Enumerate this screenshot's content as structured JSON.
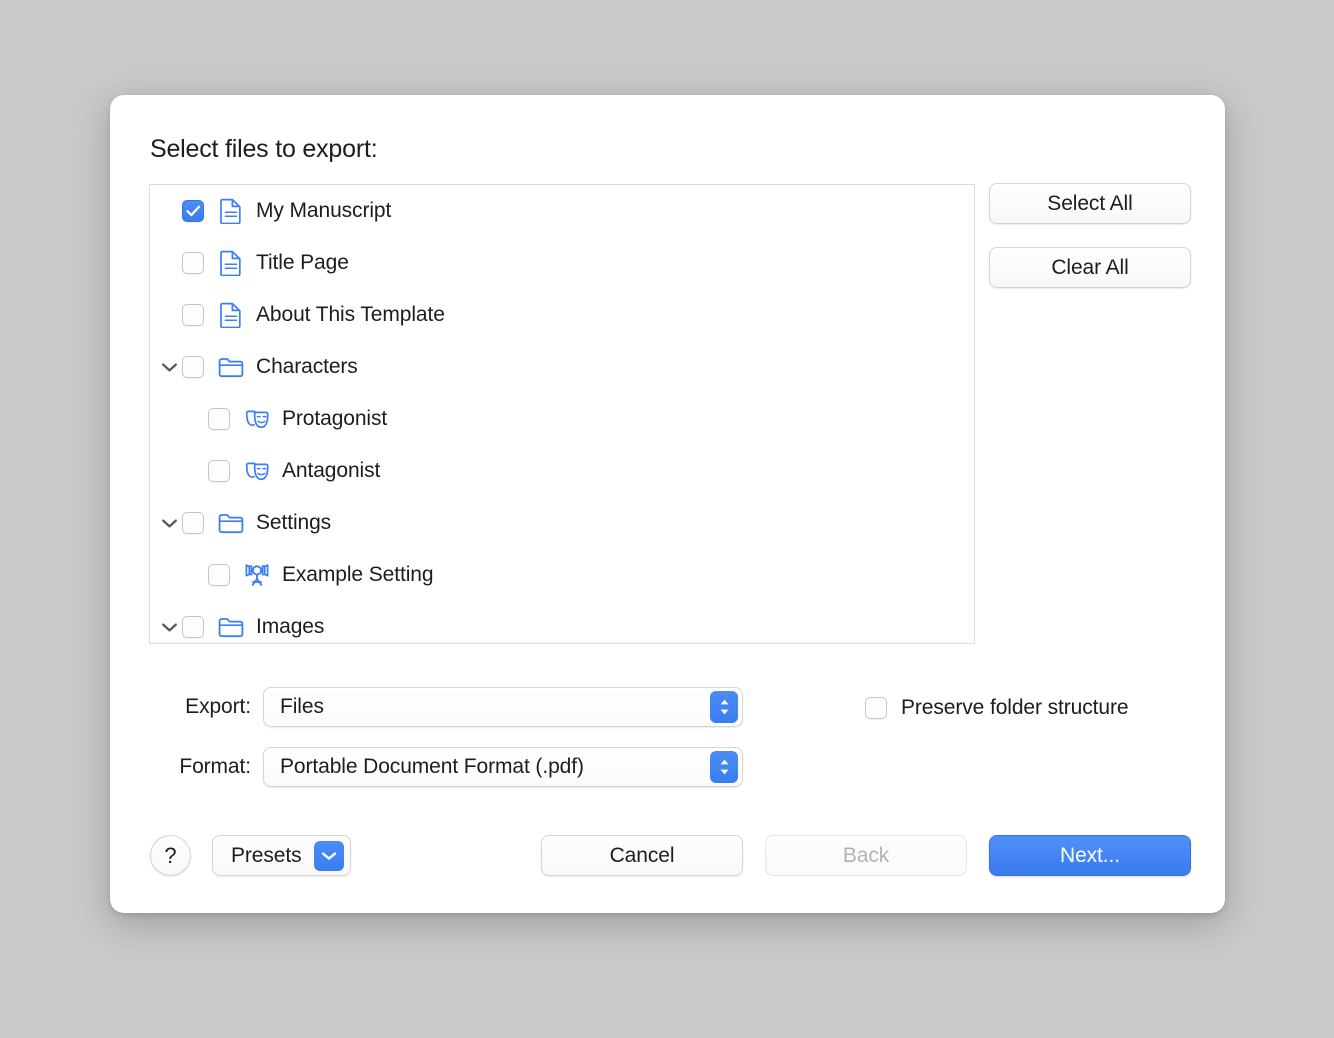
{
  "dialog": {
    "title": "Select files to export:"
  },
  "file_list": {
    "items": [
      {
        "label": "My Manuscript",
        "icon": "document-icon",
        "checked": true,
        "disclosure": "none",
        "indent": 0
      },
      {
        "label": "Title Page",
        "icon": "document-icon",
        "checked": false,
        "disclosure": "none",
        "indent": 0
      },
      {
        "label": "About This Template",
        "icon": "document-icon",
        "checked": false,
        "disclosure": "none",
        "indent": 0
      },
      {
        "label": "Characters",
        "icon": "folder-icon",
        "checked": false,
        "disclosure": "expanded",
        "indent": 0
      },
      {
        "label": "Protagonist",
        "icon": "theater-masks-icon",
        "checked": false,
        "disclosure": "none",
        "indent": 1
      },
      {
        "label": "Antagonist",
        "icon": "theater-masks-icon",
        "checked": false,
        "disclosure": "none",
        "indent": 1
      },
      {
        "label": "Settings",
        "icon": "folder-icon",
        "checked": false,
        "disclosure": "expanded",
        "indent": 0
      },
      {
        "label": "Example Setting",
        "icon": "movie-camera-icon",
        "checked": false,
        "disclosure": "none",
        "indent": 1
      },
      {
        "label": "Images",
        "icon": "folder-icon",
        "checked": false,
        "disclosure": "expanded",
        "indent": 0
      }
    ]
  },
  "side_buttons": {
    "select_all": "Select All",
    "clear_all": "Clear All"
  },
  "options": {
    "export_label": "Export:",
    "export_value": "Files",
    "format_label": "Format:",
    "format_value": "Portable Document Format (.pdf)",
    "preserve_label": "Preserve folder structure",
    "preserve_checked": false
  },
  "footer": {
    "help": "?",
    "presets": "Presets",
    "cancel": "Cancel",
    "back": "Back",
    "next": "Next..."
  },
  "colors": {
    "accent": "#3a7df1",
    "icon_blue": "#3b7ef5",
    "window_bg": "#c9c9c9",
    "dialog_bg": "#ffffff",
    "disabled_text": "#b3b3b6"
  }
}
